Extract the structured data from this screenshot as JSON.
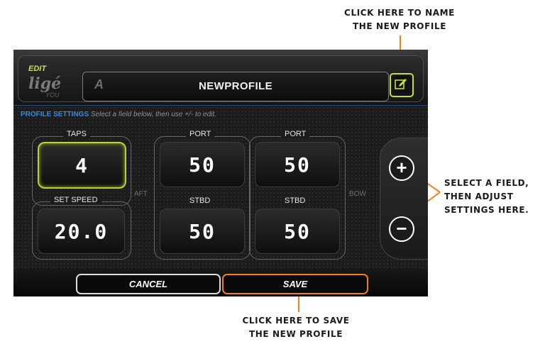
{
  "callouts": {
    "name_profile": [
      "CLICK HERE TO NAME",
      "THE NEW PROFILE"
    ],
    "adjust": [
      "SELECT A FIELD,",
      "THEN ADJUST",
      "SETTINGS HERE."
    ],
    "save_profile": [
      "CLICK HERE TO SAVE",
      "THE NEW PROFILE"
    ]
  },
  "header": {
    "logo_edit": "EDIT",
    "logo_brand": "ligé",
    "logo_you": "YOU",
    "profile_name": "NEWPROFILE",
    "edit_icon": "pencil-edit-icon"
  },
  "settings": {
    "label": "PROFILE SETTINGS",
    "hint": "Select a field below, then use +/- to edit."
  },
  "fields": {
    "taps_label": "TAPS",
    "taps_value": "4",
    "set_speed_label": "SET SPEED",
    "set_speed_value": "20.0",
    "aft_label": "AFT",
    "bow_label": "BOW",
    "aft_port_label": "PORT",
    "aft_port_value": "50",
    "aft_stbd_label": "STBD",
    "aft_stbd_value": "50",
    "bow_port_label": "PORT",
    "bow_port_value": "50",
    "bow_stbd_label": "STBD",
    "bow_stbd_value": "50"
  },
  "adjust": {
    "plus": "+",
    "minus": "−"
  },
  "footer": {
    "cancel": "CANCEL",
    "save": "SAVE"
  },
  "colors": {
    "accent": "#c4e02b",
    "callout_line": "#f07d1e",
    "link": "#2e8be0"
  }
}
